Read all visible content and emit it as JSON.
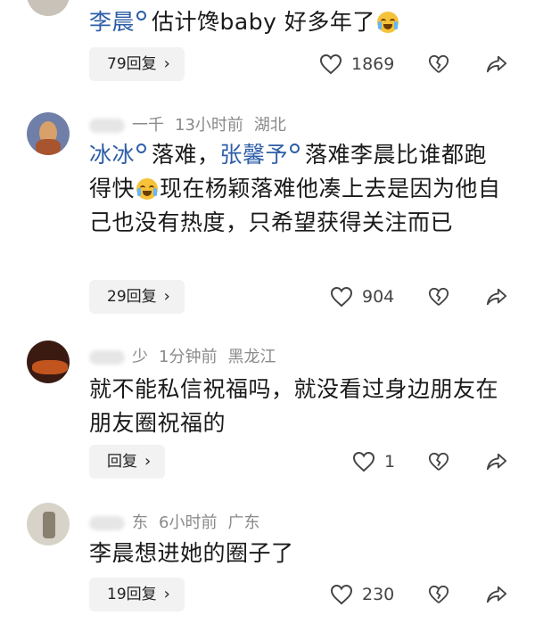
{
  "comments": [
    {
      "body_parts": [
        {
          "type": "mention",
          "text": "李晨"
        },
        {
          "type": "text",
          "text": "估计馋baby 好多年了"
        },
        {
          "type": "emoji",
          "name": "laughing-crying-emoji"
        }
      ],
      "reply_label": "79回复",
      "likes": "1869"
    },
    {
      "author_suffix": "一千",
      "time": "13小时前",
      "location": "湖北",
      "body_parts": [
        {
          "type": "mention",
          "text": "冰冰"
        },
        {
          "type": "text",
          "text": "落难，"
        },
        {
          "type": "mention",
          "text": "张馨予"
        },
        {
          "type": "text",
          "text": "落难李晨比谁都跑得快"
        },
        {
          "type": "emoji",
          "name": "laughing-crying-emoji"
        },
        {
          "type": "text",
          "text": "现在杨颖落难他凑上去是因为他自己也没有热度，只希望获得关注而已"
        }
      ],
      "reply_label": "29回复",
      "likes": "904"
    },
    {
      "author_suffix": "少",
      "time": "1分钟前",
      "location": "黑龙江",
      "body_parts": [
        {
          "type": "text",
          "text": "就不能私信祝福吗，就没看过身边朋友在朋友圈祝福的"
        }
      ],
      "reply_label": "回复",
      "likes": "1"
    },
    {
      "author_suffix": "东",
      "time": "6小时前",
      "location": "广东",
      "body_parts": [
        {
          "type": "text",
          "text": "李晨想进她的圈子了"
        }
      ],
      "reply_label": "19回复",
      "likes": "230"
    }
  ]
}
